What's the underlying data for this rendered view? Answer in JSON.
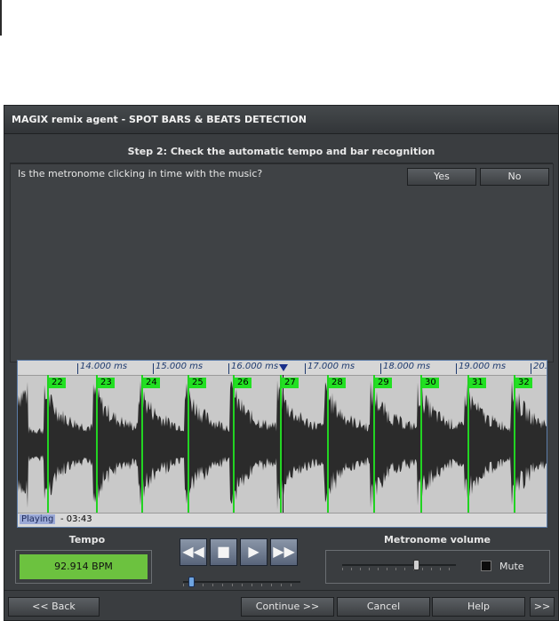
{
  "window": {
    "title": "MAGIX remix agent - SPOT BARS & BEATS DETECTION"
  },
  "step": {
    "title": "Step 2: Check the automatic tempo and bar recognition"
  },
  "question": {
    "text": "Is the metronome clicking in time with the music?",
    "yes_label": "Yes",
    "no_label": "No"
  },
  "waveform": {
    "ruler_labels": [
      "14.000 ms",
      "15.000 ms",
      "16.000 ms",
      "17.000 ms",
      "18.000 ms",
      "19.000 ms",
      "20."
    ],
    "bar_labels": [
      "22",
      "23",
      "24",
      "25",
      "26",
      "27",
      "28",
      "29",
      "30",
      "31",
      "32"
    ],
    "status": "Playing",
    "time": "- 03:43",
    "colors": {
      "bar_marker": "#22d322",
      "wave": "#2b2b2b",
      "background": "#c9c9c9"
    }
  },
  "tempo": {
    "label": "Tempo",
    "value": "92.914 BPM",
    "color": "#6cc23f"
  },
  "transport": {
    "rewind": "◀◀",
    "stop": "■",
    "play": "▶",
    "fast_forward": "▶▶",
    "position_fraction": 0.05
  },
  "metronome": {
    "label": "Metronome volume",
    "mute_label": "Mute",
    "volume_fraction": 0.66
  },
  "footer": {
    "back": "<< Back",
    "continue": "Continue >>",
    "cancel": "Cancel",
    "help": "Help",
    "more": ">>"
  }
}
